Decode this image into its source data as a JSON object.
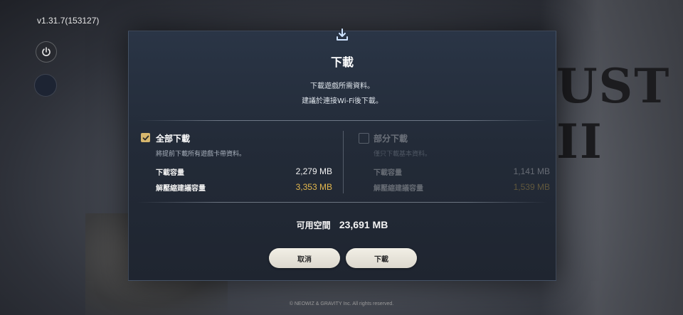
{
  "app": {
    "version": "v1.31.7(153127)",
    "logo_text": "UST II",
    "copyright": "© NEOWIZ & GRAVITY Inc. All rights reserved."
  },
  "dialog": {
    "title": "下載",
    "description_line1": "下載遊戲所需資料。",
    "description_line2": "建議於連接Wi-Fi後下載。",
    "full_download": {
      "label": "全部下載",
      "subtitle": "將提前下載所有遊戲卡帶資料。",
      "checked": true,
      "size_label": "下載容量",
      "size_value": "2,279 MB",
      "unzip_label": "解壓縮建議容量",
      "unzip_value": "3,353 MB"
    },
    "partial_download": {
      "label": "部分下載",
      "subtitle": "僅只下載基本資料。",
      "checked": false,
      "size_label": "下載容量",
      "size_value": "1,141 MB",
      "unzip_label": "解壓縮建議容量",
      "unzip_value": "1,539 MB"
    },
    "free_space_label": "可用空間",
    "free_space_value": "23,691 MB",
    "cancel_label": "取消",
    "confirm_label": "下載"
  },
  "colors": {
    "accent_gold": "#e3b74d",
    "checkbox_gold": "#d6b66d",
    "dialog_bg": "#232b38"
  },
  "icons": {
    "dialog": "download-icon",
    "power": "power-icon",
    "check": "check-icon"
  }
}
